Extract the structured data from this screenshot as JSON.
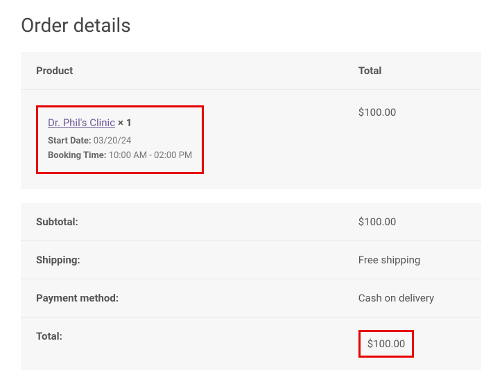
{
  "title": "Order details",
  "columns": {
    "product": "Product",
    "total": "Total"
  },
  "item": {
    "name": "Dr. Phil's Clinic",
    "qty_prefix": "×",
    "qty": "1",
    "start_date_label": "Start Date:",
    "start_date": "03/20/24",
    "booking_time_label": "Booking Time:",
    "booking_time": "10:00 AM - 02:00 PM",
    "price": "$100.00"
  },
  "summary": {
    "subtotal_label": "Subtotal:",
    "subtotal_value": "$100.00",
    "shipping_label": "Shipping:",
    "shipping_value": "Free shipping",
    "payment_label": "Payment method:",
    "payment_value": "Cash on delivery",
    "total_label": "Total:",
    "total_value": "$100.00"
  }
}
